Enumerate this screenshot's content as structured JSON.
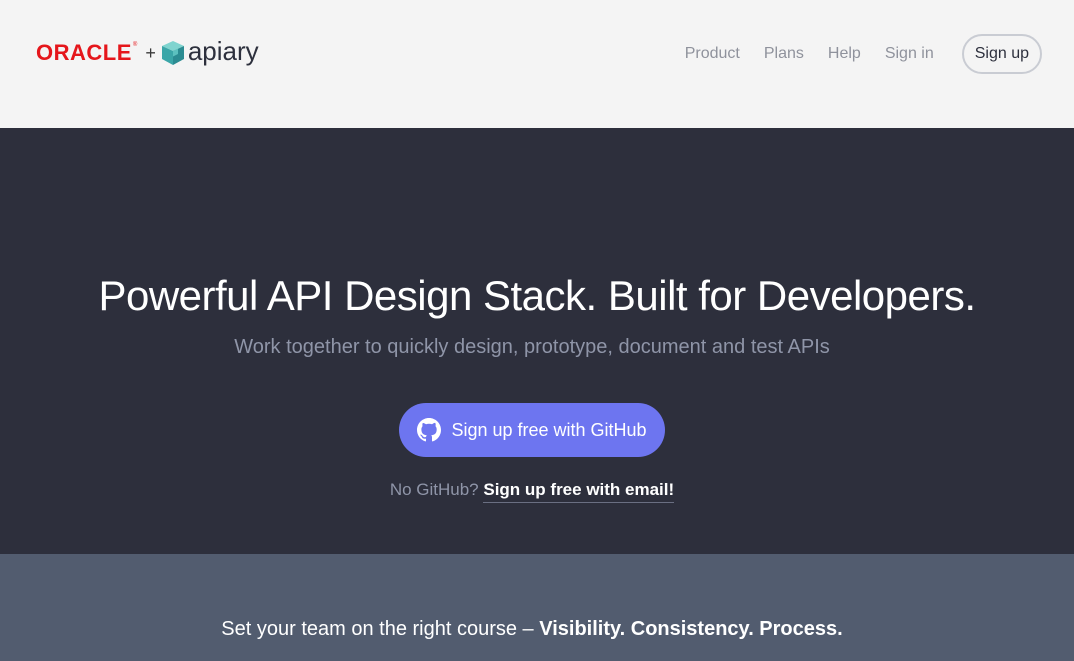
{
  "header": {
    "logo": {
      "oracle": "ORACLE",
      "registered": "®",
      "plus": "+",
      "apiary": "apiary",
      "icon": "apiary-cube-icon"
    },
    "nav": {
      "items": [
        {
          "label": "Product"
        },
        {
          "label": "Plans"
        },
        {
          "label": "Help"
        },
        {
          "label": "Sign in"
        }
      ],
      "signup_label": "Sign up"
    }
  },
  "hero": {
    "title": "Powerful API Design Stack. Built for Developers.",
    "subtitle": "Work together to quickly design, prototype, document and test APIs",
    "github_button": {
      "label": "Sign up free with GitHub",
      "icon": "github-icon"
    },
    "alt_prefix": "No GitHub?",
    "alt_link": "Sign up free with email!"
  },
  "band": {
    "text": "Set your team on the right course – ",
    "strong": "Visibility. Consistency. Process."
  },
  "colors": {
    "header_bg": "#f4f4f4",
    "hero_bg": "#2d2f3c",
    "band_bg": "#525c6f",
    "accent": "#6d75f0",
    "oracle_red": "#e5161b",
    "apiary_teal": "#4bb5b4"
  }
}
